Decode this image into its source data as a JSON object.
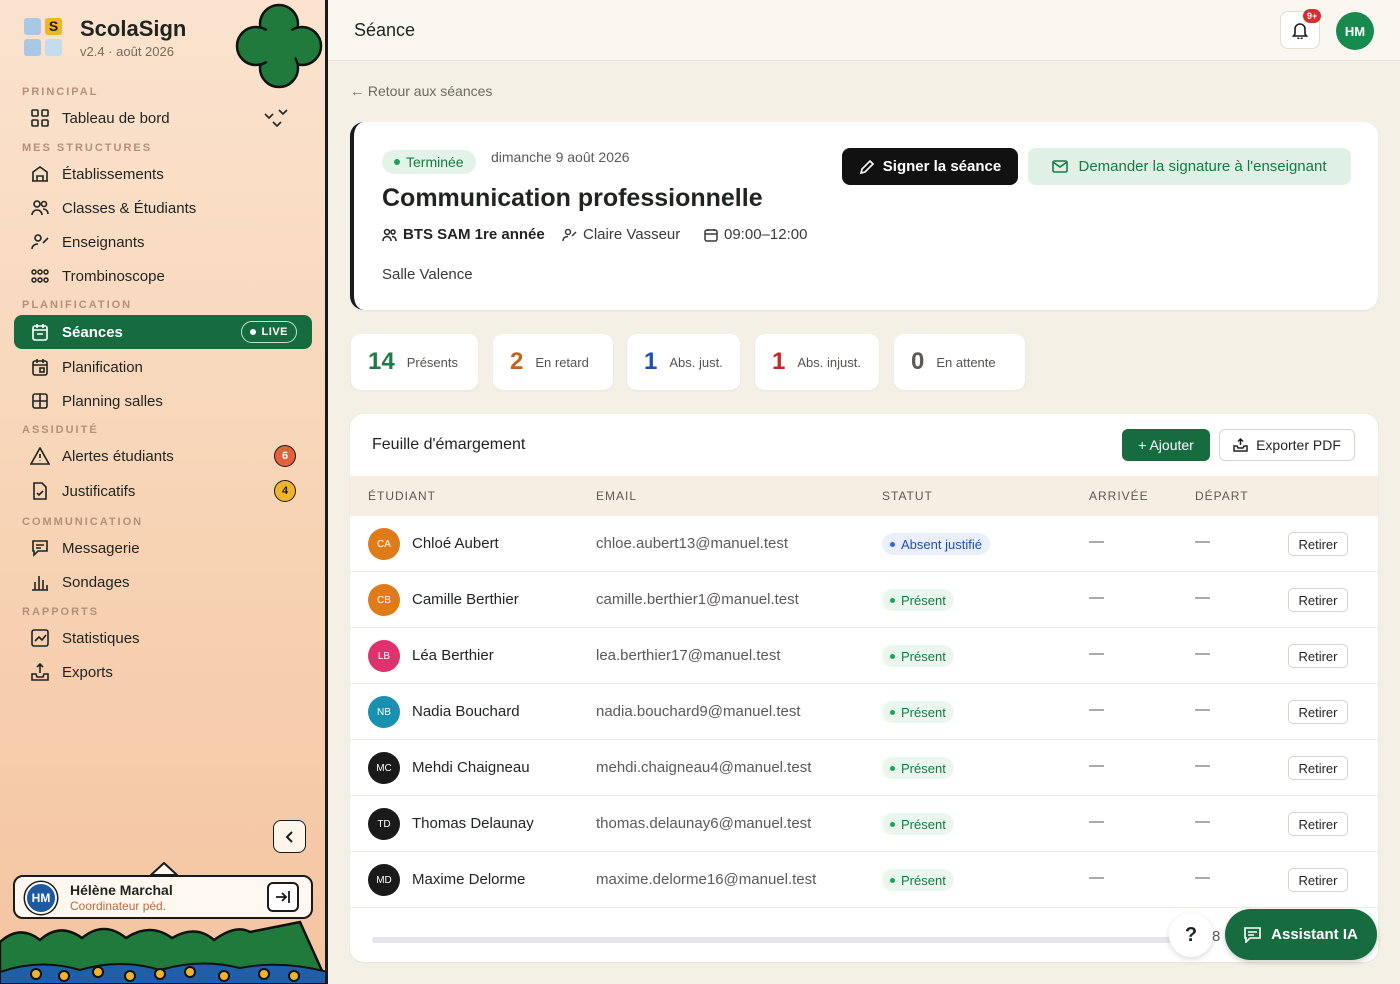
{
  "app": {
    "name": "ScolaSign",
    "version": "v2.4 · août 2026"
  },
  "sidebar": {
    "sections": [
      "PRINCIPAL",
      "MES STRUCTURES",
      "PLANIFICATION",
      "ASSIDUITÉ",
      "COMMUNICATION",
      "RAPPORTS"
    ],
    "items": [
      {
        "label": "Tableau de bord",
        "icon": "dashboard-icon"
      },
      {
        "label": "Établissements",
        "icon": "building-icon"
      },
      {
        "label": "Classes & Étudiants",
        "icon": "users-icon"
      },
      {
        "label": "Enseignants",
        "icon": "teacher-icon"
      },
      {
        "label": "Trombinoscope",
        "icon": "grid-users-icon"
      },
      {
        "label": "Séances",
        "icon": "calendar-icon",
        "badge": "LIVE",
        "active": true
      },
      {
        "label": "Planification",
        "icon": "calendar-plan-icon"
      },
      {
        "label": "Planning salles",
        "icon": "rooms-icon"
      },
      {
        "label": "Alertes étudiants",
        "icon": "alert-icon",
        "count": "6"
      },
      {
        "label": "Justificatifs",
        "icon": "document-check-icon",
        "count": "4"
      },
      {
        "label": "Messagerie",
        "icon": "message-icon"
      },
      {
        "label": "Sondages",
        "icon": "poll-icon"
      },
      {
        "label": "Statistiques",
        "icon": "chart-icon"
      },
      {
        "label": "Exports",
        "icon": "export-icon"
      }
    ],
    "user": {
      "initials": "HM",
      "name": "Hélène Marchal",
      "role": "Coordinateur péd."
    }
  },
  "topbar": {
    "title": "Séance",
    "notif_count": "9+",
    "avatar": "HM"
  },
  "back_link": "← Retour aux séances",
  "session": {
    "status": "Terminée",
    "date": "dimanche 9 août 2026",
    "title": "Communication professionnelle",
    "class": "BTS SAM 1re année",
    "teacher": "Claire Vasseur",
    "time": "09:00–12:00",
    "room": "Salle Valence",
    "sign_button": "Signer la séance",
    "request_button": "Demander la signature à l'enseignant"
  },
  "stats": [
    {
      "value": "14",
      "label": "Présents",
      "color": "#1f7a4a"
    },
    {
      "value": "2",
      "label": "En retard",
      "color": "#c2631c"
    },
    {
      "value": "1",
      "label": "Abs. just.",
      "color": "#1f4fb0"
    },
    {
      "value": "1",
      "label": "Abs. injust.",
      "color": "#c62828"
    },
    {
      "value": "0",
      "label": "En attente",
      "color": "#5c5a55"
    }
  ],
  "sheet": {
    "title": "Feuille d'émargement",
    "add_button": "+ Ajouter",
    "export_button": "Exporter PDF",
    "columns": [
      "ÉTUDIANT",
      "EMAIL",
      "STATUT",
      "ARRIVÉE",
      "DÉPART"
    ],
    "remove_label": "Retirer",
    "rows": [
      {
        "initials": "CA",
        "name": "Chloé Aubert",
        "email": "chloe.aubert13@manuel.test",
        "status": "Absent justifié",
        "arrival": "—",
        "departure": "—",
        "color": "#e07b1a",
        "kind": "b"
      },
      {
        "initials": "CB",
        "name": "Camille Berthier",
        "email": "camille.berthier1@manuel.test",
        "status": "Présent",
        "arrival": "—",
        "departure": "—",
        "color": "#e07b1a",
        "kind": "g"
      },
      {
        "initials": "LB",
        "name": "Léa Berthier",
        "email": "lea.berthier17@manuel.test",
        "status": "Présent",
        "arrival": "—",
        "departure": "—",
        "color": "#e0306e",
        "kind": "g"
      },
      {
        "initials": "NB",
        "name": "Nadia Bouchard",
        "email": "nadia.bouchard9@manuel.test",
        "status": "Présent",
        "arrival": "—",
        "departure": "—",
        "color": "#1891b0",
        "kind": "g"
      },
      {
        "initials": "MC",
        "name": "Mehdi Chaigneau",
        "email": "mehdi.chaigneau4@manuel.test",
        "status": "Présent",
        "arrival": "—",
        "departure": "—",
        "color": "#1a1a1a",
        "kind": "g"
      },
      {
        "initials": "TD",
        "name": "Thomas Delaunay",
        "email": "thomas.delaunay6@manuel.test",
        "status": "Présent",
        "arrival": "—",
        "departure": "—",
        "color": "#1a1a1a",
        "kind": "g"
      },
      {
        "initials": "MD",
        "name": "Maxime Delorme",
        "email": "maxime.delorme16@manuel.test",
        "status": "Présent",
        "arrival": "—",
        "departure": "—",
        "color": "#1a1a1a",
        "kind": "g"
      }
    ]
  },
  "help": {
    "icon": "?",
    "count": "8"
  },
  "assistant_button": "Assistant IA"
}
